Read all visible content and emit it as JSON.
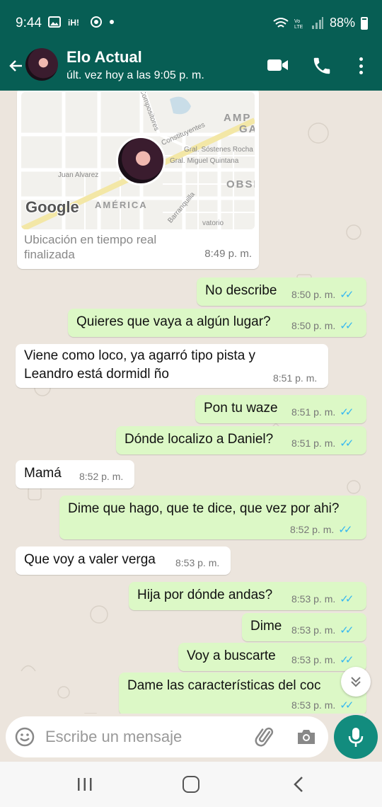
{
  "status_bar": {
    "time": "9:44",
    "icons_left": [
      "image-icon",
      "app-icon",
      "chrome-icon",
      "dot"
    ],
    "icons_right": [
      "wifi-icon",
      "volte-icon",
      "signal-icon"
    ],
    "battery": "88%"
  },
  "header": {
    "contact_name": "Elo Actual",
    "last_seen": "últ. vez hoy a las 9:05 p. m.",
    "background": "#075e54"
  },
  "location_card": {
    "map_labels": [
      "Constituyentes",
      "AMP D",
      "GA",
      "Gral. Sóstenes Rocha",
      "Gral. Miguel Quintana",
      "OBSE",
      "Juan Alvarez",
      "AMÉRICA",
      "Barranquilla",
      "vatorio",
      "Compositores"
    ],
    "logo": "Google",
    "caption": "Ubicación en tiempo real finalizada",
    "time": "8:49 p. m."
  },
  "messages": [
    {
      "dir": "out",
      "text": "No describe",
      "time": "8:50 p. m."
    },
    {
      "dir": "out",
      "text": "Quieres que vaya a algún lugar?",
      "time": "8:50 p. m."
    },
    {
      "dir": "in",
      "text": "Viene como loco, ya agarró tipo pista y",
      "text2": "Leandro está dormidl ño",
      "time": "8:51 p. m."
    },
    {
      "dir": "out",
      "text": "Pon tu waze",
      "time": "8:51 p. m."
    },
    {
      "dir": "out",
      "text": "Dónde localizo a Daniel?",
      "time": "8:51 p. m."
    },
    {
      "dir": "in",
      "text": "Mamá",
      "time": "8:52 p. m."
    },
    {
      "dir": "out",
      "text": "Dime que hago, que te dice, que vez por ahi?",
      "time": "8:52 p. m."
    },
    {
      "dir": "in",
      "text": "Que voy a valer verga",
      "time": "8:53 p. m."
    },
    {
      "dir": "out",
      "text": "Hija por dónde andas?",
      "time": "8:53 p. m."
    },
    {
      "dir": "out",
      "text": "Dime",
      "time": "8:53 p. m."
    },
    {
      "dir": "out",
      "text": "Voy a buscarte",
      "time": "8:53 p. m."
    },
    {
      "dir": "out",
      "text": "Dame las características del coc",
      "time": "8:53 p. m."
    }
  ],
  "input": {
    "placeholder": "Escribe un mensaje"
  },
  "colors": {
    "header": "#075e54",
    "outgoing_bubble": "#dcf8c6",
    "incoming_bubble": "#ffffff",
    "read_ticks": "#34b7f1",
    "mic_button": "#128c7e",
    "chat_background": "#ece5dd"
  }
}
